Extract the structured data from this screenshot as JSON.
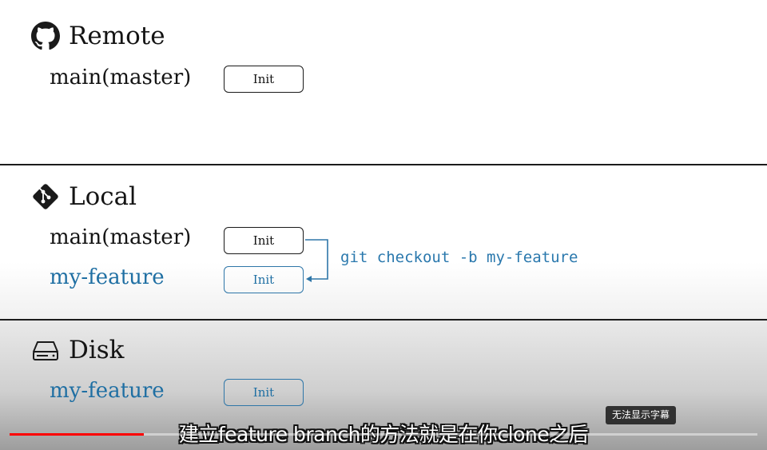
{
  "remote": {
    "title": "Remote",
    "icon": "github-icon",
    "branch": "main(master)",
    "commit": "Init"
  },
  "local": {
    "title": "Local",
    "icon": "git-icon",
    "branches": [
      {
        "name": "main(master)",
        "commit": "Init"
      },
      {
        "name": "my-feature",
        "commit": "Init"
      }
    ],
    "command": "git checkout -b my-feature"
  },
  "disk": {
    "title": "Disk",
    "icon": "disk-drive-icon",
    "branch": "my-feature",
    "commit": "Init"
  },
  "player": {
    "subtitle": "建立feature branch的方法就是在你clone之后",
    "caption_notice": "无法显示字幕",
    "progress": 0.18,
    "progress_color": "#ff0000"
  },
  "colors": {
    "accent_blue": "#1f6fa3",
    "text_dark": "#141414"
  }
}
